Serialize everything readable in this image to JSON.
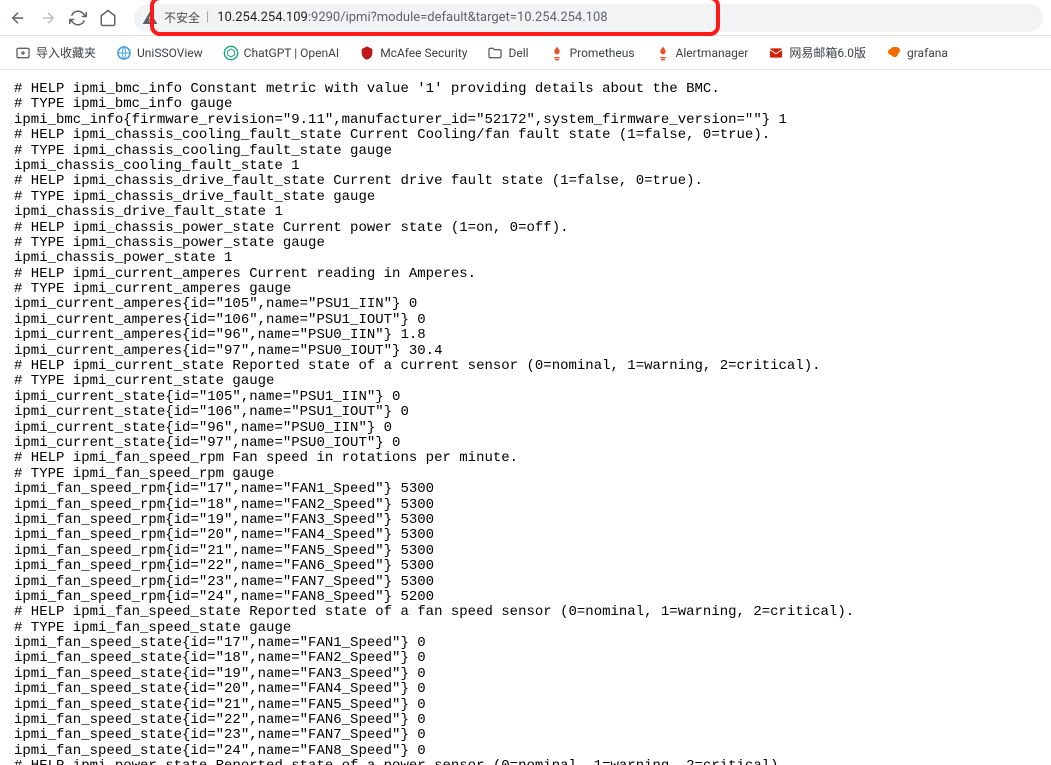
{
  "toolbar": {
    "security_label": "不安全",
    "url_host": "10.254.254.109",
    "url_rest": ":9290/ipmi?module=default&target=10.254.254.108"
  },
  "bookmarks": {
    "import": "导入收藏夹",
    "items": [
      {
        "label": "UniSSOView"
      },
      {
        "label": "ChatGPT | OpenAI"
      },
      {
        "label": "McAfee Security"
      },
      {
        "label": "Dell"
      },
      {
        "label": "Prometheus"
      },
      {
        "label": "Alertmanager"
      },
      {
        "label": "网易邮箱6.0版"
      },
      {
        "label": "grafana"
      }
    ]
  },
  "page_content": "# HELP ipmi_bmc_info Constant metric with value '1' providing details about the BMC.\n# TYPE ipmi_bmc_info gauge\nipmi_bmc_info{firmware_revision=\"9.11\",manufacturer_id=\"52172\",system_firmware_version=\"\"} 1\n# HELP ipmi_chassis_cooling_fault_state Current Cooling/fan fault state (1=false, 0=true).\n# TYPE ipmi_chassis_cooling_fault_state gauge\nipmi_chassis_cooling_fault_state 1\n# HELP ipmi_chassis_drive_fault_state Current drive fault state (1=false, 0=true).\n# TYPE ipmi_chassis_drive_fault_state gauge\nipmi_chassis_drive_fault_state 1\n# HELP ipmi_chassis_power_state Current power state (1=on, 0=off).\n# TYPE ipmi_chassis_power_state gauge\nipmi_chassis_power_state 1\n# HELP ipmi_current_amperes Current reading in Amperes.\n# TYPE ipmi_current_amperes gauge\nipmi_current_amperes{id=\"105\",name=\"PSU1_IIN\"} 0\nipmi_current_amperes{id=\"106\",name=\"PSU1_IOUT\"} 0\nipmi_current_amperes{id=\"96\",name=\"PSU0_IIN\"} 1.8\nipmi_current_amperes{id=\"97\",name=\"PSU0_IOUT\"} 30.4\n# HELP ipmi_current_state Reported state of a current sensor (0=nominal, 1=warning, 2=critical).\n# TYPE ipmi_current_state gauge\nipmi_current_state{id=\"105\",name=\"PSU1_IIN\"} 0\nipmi_current_state{id=\"106\",name=\"PSU1_IOUT\"} 0\nipmi_current_state{id=\"96\",name=\"PSU0_IIN\"} 0\nipmi_current_state{id=\"97\",name=\"PSU0_IOUT\"} 0\n# HELP ipmi_fan_speed_rpm Fan speed in rotations per minute.\n# TYPE ipmi_fan_speed_rpm gauge\nipmi_fan_speed_rpm{id=\"17\",name=\"FAN1_Speed\"} 5300\nipmi_fan_speed_rpm{id=\"18\",name=\"FAN2_Speed\"} 5300\nipmi_fan_speed_rpm{id=\"19\",name=\"FAN3_Speed\"} 5300\nipmi_fan_speed_rpm{id=\"20\",name=\"FAN4_Speed\"} 5300\nipmi_fan_speed_rpm{id=\"21\",name=\"FAN5_Speed\"} 5300\nipmi_fan_speed_rpm{id=\"22\",name=\"FAN6_Speed\"} 5300\nipmi_fan_speed_rpm{id=\"23\",name=\"FAN7_Speed\"} 5300\nipmi_fan_speed_rpm{id=\"24\",name=\"FAN8_Speed\"} 5200\n# HELP ipmi_fan_speed_state Reported state of a fan speed sensor (0=nominal, 1=warning, 2=critical).\n# TYPE ipmi_fan_speed_state gauge\nipmi_fan_speed_state{id=\"17\",name=\"FAN1_Speed\"} 0\nipmi_fan_speed_state{id=\"18\",name=\"FAN2_Speed\"} 0\nipmi_fan_speed_state{id=\"19\",name=\"FAN3_Speed\"} 0\nipmi_fan_speed_state{id=\"20\",name=\"FAN4_Speed\"} 0\nipmi_fan_speed_state{id=\"21\",name=\"FAN5_Speed\"} 0\nipmi_fan_speed_state{id=\"22\",name=\"FAN6_Speed\"} 0\nipmi_fan_speed_state{id=\"23\",name=\"FAN7_Speed\"} 0\nipmi_fan_speed_state{id=\"24\",name=\"FAN8_Speed\"} 0\n# HELP ipmi_power_state Reported state of a power sensor (0=nominal, 1=warning, 2=critical).\n"
}
